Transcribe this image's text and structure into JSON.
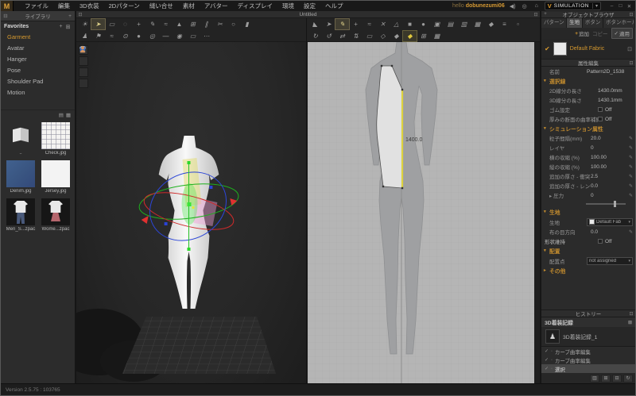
{
  "menubar": {
    "logo": "M",
    "menus": [
      "ファイル",
      "編集",
      "3D衣装",
      "2Dパターン",
      "縫い合せ",
      "素材",
      "アバター",
      "ディスプレイ",
      "環境",
      "設定",
      "ヘルプ"
    ],
    "account_prefix": "hello",
    "account_name": "dobunezumi06",
    "speaker_icon": "◀)",
    "help_icon": "◎",
    "store_icon": "⌂",
    "simulation": {
      "logo": "V",
      "label": "SIMULATION",
      "caret": "▾"
    },
    "window": {
      "minimize": "–",
      "maximize": "□",
      "close": "✕"
    }
  },
  "library": {
    "title": "ライブラリ",
    "collapse_icon": "⊟",
    "add_icon": "+",
    "favorites_label": "Favorites",
    "fav_icons": [
      "+",
      "⊞"
    ],
    "nav": [
      {
        "label": "Garment",
        "name": "sidebar-item-garment",
        "state": "active"
      },
      {
        "label": "Avatar",
        "name": "sidebar-item-avatar"
      },
      {
        "label": "Hanger",
        "name": "sidebar-item-hanger"
      },
      {
        "label": "Pose",
        "name": "sidebar-item-pose"
      },
      {
        "label": "Shoulder Pad",
        "name": "sidebar-item-shoulder-pad"
      },
      {
        "label": "Motion",
        "name": "sidebar-item-motion"
      }
    ],
    "view_icons": [
      "▤",
      "▦"
    ],
    "thumbs": [
      {
        "label": "..",
        "kind": "folder"
      },
      {
        "label": "Check.jpg",
        "kind": "check"
      },
      {
        "label": "Denim.jpg",
        "kind": "denim"
      },
      {
        "label": "Jersey.jpg",
        "kind": "jersey"
      },
      {
        "label": "Men_S...zpac",
        "kind": "men"
      },
      {
        "label": "Wome...zpac",
        "kind": "women"
      }
    ]
  },
  "viewport": {
    "title": "Untitled",
    "window_icon": "⊡",
    "detach_icon": "⊡",
    "measurement": "1400.0",
    "toolbar3d_row1": [
      {
        "glyph": "☀",
        "name": "gizmo-light-tool"
      },
      {
        "glyph": "➤",
        "name": "select-move-tool",
        "state": "active"
      },
      {
        "glyph": "▭",
        "name": "rect-select-tool"
      },
      {
        "glyph": "◌",
        "name": "lasso-select-tool"
      },
      {
        "glyph": "+",
        "name": "mesh-select-tool"
      },
      {
        "glyph": "✎",
        "name": "sewing-tool"
      },
      {
        "glyph": "≈",
        "name": "free-sewing-tool"
      },
      {
        "glyph": "▲",
        "name": "fold-arrangement-tool"
      },
      {
        "glyph": "⊞",
        "name": "pattern-window-tool"
      },
      {
        "glyph": "∥",
        "name": "pin-tool"
      },
      {
        "glyph": "✂",
        "name": "scissors-tool"
      },
      {
        "glyph": "○",
        "name": "ring-tool"
      },
      {
        "glyph": "▮",
        "name": "pole-tool"
      }
    ],
    "toolbar3d_row2": [
      {
        "glyph": "♟",
        "name": "avatar-tool"
      },
      {
        "glyph": "⚑",
        "name": "flag-tool"
      },
      {
        "glyph": "≈",
        "name": "wind-tool"
      },
      {
        "glyph": "⊙",
        "name": "target-tool"
      },
      {
        "glyph": "●",
        "name": "sphere-tool"
      },
      {
        "glyph": "◎",
        "name": "disc-tool"
      },
      {
        "glyph": "—",
        "name": "line-tool"
      },
      {
        "glyph": "◉",
        "name": "point-tool"
      },
      {
        "glyph": "▭",
        "name": "plane-tool"
      },
      {
        "glyph": "⋯",
        "name": "more-tool"
      }
    ],
    "toolbar2d_row1": [
      {
        "glyph": "◣",
        "name": "transform-pattern-tool"
      },
      {
        "glyph": "➤",
        "name": "edit-pattern-tool"
      },
      {
        "glyph": "✎",
        "name": "edit-point-tool",
        "state": "active"
      },
      {
        "glyph": "+",
        "name": "add-point-tool"
      },
      {
        "glyph": "≈",
        "name": "edit-curve-tool"
      },
      {
        "glyph": "✕",
        "name": "edit-curvature-tool"
      },
      {
        "glyph": "△",
        "name": "polygon-tool"
      },
      {
        "glyph": "■",
        "name": "rectangle-tool"
      },
      {
        "glyph": "●",
        "name": "circle-tool"
      },
      {
        "glyph": "▣",
        "name": "internal-polygon-tool"
      },
      {
        "glyph": "▤",
        "name": "internal-rect-tool"
      },
      {
        "glyph": "▥",
        "name": "internal-circle-tool"
      },
      {
        "glyph": "▦",
        "name": "dart-tool"
      },
      {
        "glyph": "◆",
        "name": "seam-tape-tool"
      },
      {
        "glyph": "≡",
        "name": "trace-tool"
      },
      {
        "glyph": "▫",
        "name": "notch-tool"
      }
    ],
    "toolbar2d_row2": [
      {
        "glyph": "↻",
        "name": "rotate-cw-tool"
      },
      {
        "glyph": "↺",
        "name": "rotate-ccw-tool"
      },
      {
        "glyph": "⇄",
        "name": "flip-horizontal-tool"
      },
      {
        "glyph": "⇅",
        "name": "flip-vertical-tool"
      },
      {
        "glyph": "▭",
        "name": "iron-tool"
      },
      {
        "glyph": "◇",
        "name": "layer-tool"
      },
      {
        "glyph": "◆",
        "name": "sync-tool"
      },
      {
        "glyph": "◆",
        "name": "show-3d-pattern-tool",
        "state": "active-yellow"
      },
      {
        "glyph": "⊞",
        "name": "grid-tool"
      },
      {
        "glyph": "▦",
        "name": "texture-editor-tool"
      }
    ]
  },
  "object_browser": {
    "title": "オブジェクトブラウザ",
    "add_tab_icon": "+",
    "detach_icon": "⊡",
    "tabs": [
      {
        "label": "パターン"
      },
      {
        "label": "生地",
        "state": "active"
      },
      {
        "label": "ボタン"
      },
      {
        "label": "ボタンホール"
      }
    ],
    "add_label": "追加",
    "copy_label": "コピー",
    "apply_label": "適用",
    "apply_icon": "✓",
    "fabric_check": "✔",
    "fabric_name": "Default Fabric",
    "fabric_edit_icon": "⊡"
  },
  "properties": {
    "title": "属性編集",
    "detach_icon": "⊡",
    "pencil_icon": "✎",
    "caret_icon": "▾",
    "name_label": "名前",
    "name_value": "Pattern2D_1538",
    "sec_selection": "選択線",
    "len2d": {
      "label": "2D線分の長さ",
      "value": "1430.0mm"
    },
    "len3d": {
      "label": "3D線分の長さ",
      "value": "1430.1mm"
    },
    "elastic": {
      "label": "ゴム設定",
      "value": "Off"
    },
    "thickness_curve": {
      "label": "厚みの断面の曲率補間",
      "value": "Off"
    },
    "sec_simulation": "シミュレーション属性",
    "particle": {
      "label": "粒子間隔(mm)",
      "value": "20.0"
    },
    "layer": {
      "label": "レイヤ",
      "value": "0"
    },
    "shrink_w": {
      "label": "横の収縮 (%)",
      "value": "100.00"
    },
    "shrink_h": {
      "label": "縦の収縮 (%)",
      "value": "100.00"
    },
    "thick_collision": {
      "label": "追加の厚さ - 衝突 (mm",
      "value": "2.5"
    },
    "thick_render": {
      "label": "追加の厚さ - レンダリング",
      "value": "0.0"
    },
    "pressure": {
      "label": "圧力",
      "value": "0"
    },
    "sec_fabric": "生地",
    "fabric_row": {
      "label": "生地",
      "value": "Default Fab"
    },
    "grain": {
      "label": "布の目方向",
      "value": "0.0"
    },
    "shape_keep": {
      "label": "形状維持",
      "value": "Off"
    },
    "sec_arrange": "配置",
    "arrange_point": {
      "label": "配置点",
      "value": "not assigned"
    },
    "sec_other": "その他"
  },
  "history": {
    "title": "ヒストリー",
    "detach_icon": "⊡",
    "record_title": "3D着装記録",
    "record_icon": "⊞",
    "record_item": "3D着装記録_1",
    "entries": [
      {
        "label": "カーブ曲率編集"
      },
      {
        "label": "カーブ曲率編集"
      },
      {
        "label": "選択",
        "state": "active"
      }
    ],
    "footer_icons": [
      "▥",
      "⊞",
      "⊟",
      "↻"
    ]
  },
  "statusbar": {
    "text": "Version 2.5.75 : 103765"
  }
}
